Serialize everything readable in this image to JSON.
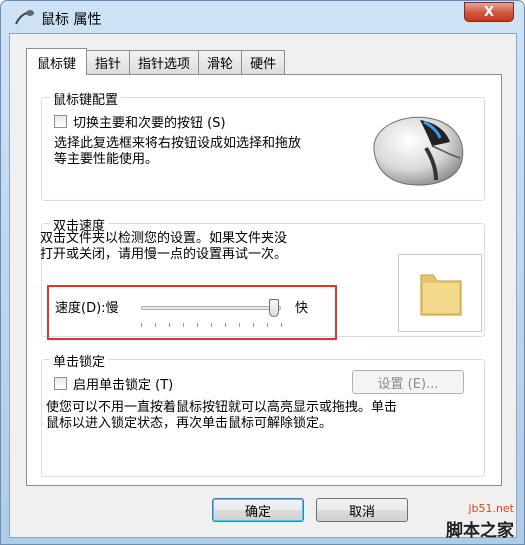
{
  "window": {
    "title": "鼠标 属性",
    "close_label": "X"
  },
  "tabs": [
    {
      "label": "鼠标键"
    },
    {
      "label": "指针"
    },
    {
      "label": "指针选项"
    },
    {
      "label": "滑轮"
    },
    {
      "label": "硬件"
    }
  ],
  "button_config": {
    "heading": "鼠标键配置",
    "switch_label": "切换主要和次要的按钮 (S)",
    "description_line1": "选择此复选框来将右按钮设成如选择和拖放",
    "description_line2": "等主要性能使用。"
  },
  "double_click": {
    "heading": "双击速度",
    "description_line1": "双击文件夹以检测您的设置。如果文件夹没",
    "description_line2": "打开或关闭，请用慢一点的设置再试一次。",
    "speed_label": "速度(D):慢",
    "fast_label": "快",
    "slider_value": 0.95
  },
  "click_lock": {
    "heading": "单击锁定",
    "enable_label": "启用单击锁定 (T)",
    "settings_label": "设置 (E)...",
    "description_line1": "使您可以不用一直按着鼠标按钮就可以高亮显示或拖拽。单击",
    "description_line2": "鼠标以进入锁定状态，再次单击鼠标可解除锁定。"
  },
  "footer": {
    "ok_label": "确定",
    "cancel_label": "取消"
  },
  "watermark": {
    "url": "jb51.net",
    "text": "脚本之家"
  }
}
